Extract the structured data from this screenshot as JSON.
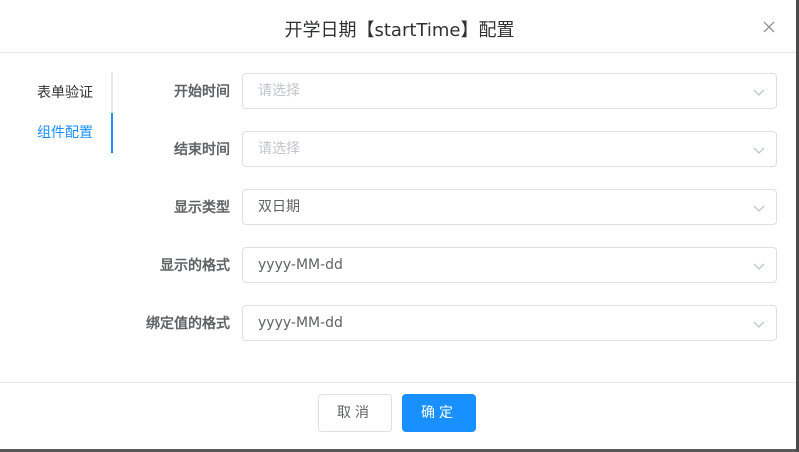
{
  "dialog": {
    "title": "开学日期【startTime】配置",
    "close_icon": "close-icon"
  },
  "tabs": [
    {
      "label": "表单验证",
      "active": false
    },
    {
      "label": "组件配置",
      "active": true
    }
  ],
  "form": {
    "rows": [
      {
        "label": "开始时间",
        "value": "",
        "placeholder": "请选择"
      },
      {
        "label": "结束时间",
        "value": "",
        "placeholder": "请选择"
      },
      {
        "label": "显示类型",
        "value": "双日期",
        "placeholder": ""
      },
      {
        "label": "显示的格式",
        "value": "yyyy-MM-dd",
        "placeholder": ""
      },
      {
        "label": "绑定值的格式",
        "value": "yyyy-MM-dd",
        "placeholder": ""
      }
    ]
  },
  "footer": {
    "cancel_label": "取消",
    "confirm_label": "确定"
  },
  "colors": {
    "accent": "#1890ff",
    "border": "#dcdfe6",
    "placeholder": "#c0c4cc"
  }
}
